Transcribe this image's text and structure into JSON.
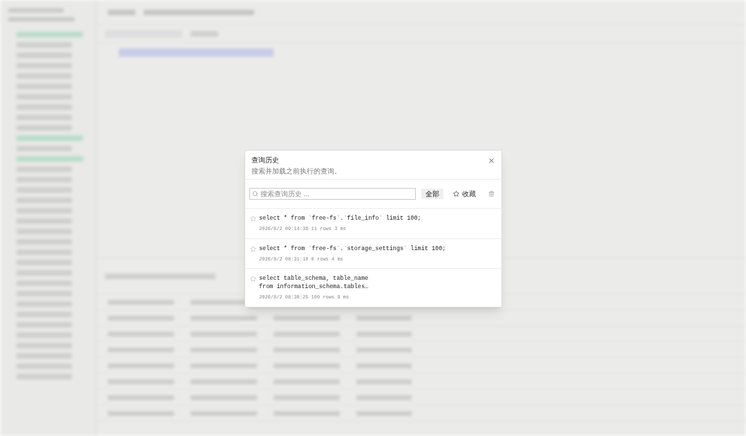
{
  "dialog": {
    "title": "查询历史",
    "subtitle": "搜索并加载之前执行的查询。",
    "search": {
      "placeholder": "搜索查询历史 ..."
    },
    "filters": [
      {
        "kind": "all",
        "label": "全部",
        "selected": true
      },
      {
        "kind": "favorites",
        "label": "收藏",
        "selected": false
      }
    ],
    "entries": [
      {
        "query_lines": [
          "select * from `free-fs`.`file_info` limit 100;"
        ],
        "meta": "2026/8/2 09:14:36 11 rows 3 ms",
        "starred": false
      },
      {
        "query_lines": [
          "select * from `free-fs`.`storage_settings` limit 100;"
        ],
        "meta": "2026/8/2 08:31:10 0 rows 4 ms",
        "starred": false
      },
      {
        "query_lines": [
          "select table_schema, table_name",
          "from information_schema.tables…"
        ],
        "meta": "2026/8/2 08:30:25 100 rows 9 ms",
        "starred": false
      }
    ]
  }
}
